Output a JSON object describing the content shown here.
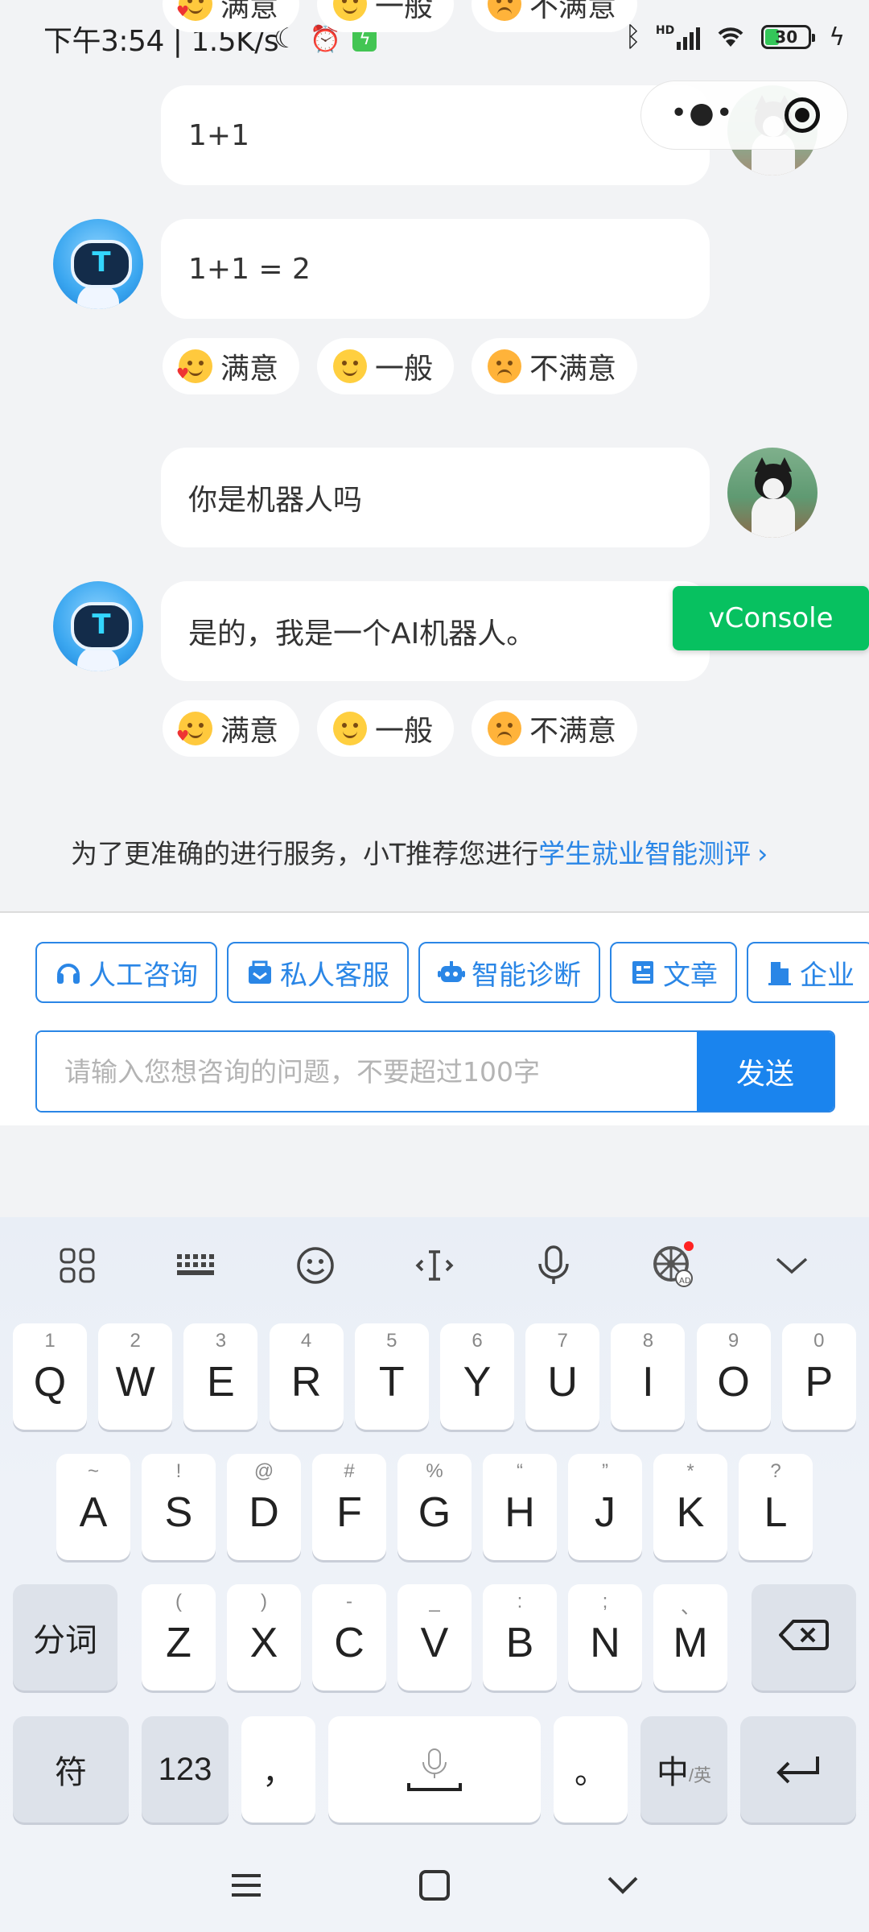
{
  "status_bar": {
    "left_text": "下午3:54 | 1.5K/s",
    "battery": "30",
    "hd_label": "HD"
  },
  "chat": {
    "messages": [
      {
        "role": "user",
        "text": "1+1"
      },
      {
        "role": "bot",
        "text": "1+1 = 2"
      },
      {
        "role": "user",
        "text": "你是机器人吗"
      },
      {
        "role": "bot",
        "text": "是的，我是一个AI机器人。"
      }
    ],
    "ratings": {
      "satisfied": "满意",
      "neutral": "一般",
      "unsatisfied": "不满意"
    },
    "bot_avatar_letter": "T"
  },
  "vconsole_label": "vConsole",
  "recommendation": {
    "prefix": "为了更准确的进行服务，小T推荐您进行",
    "link": "学生就业智能测评",
    "chevron": "›"
  },
  "quick_actions": [
    {
      "label": "人工咨询",
      "icon": "headphones-icon"
    },
    {
      "label": "私人客服",
      "icon": "service-icon"
    },
    {
      "label": "智能诊断",
      "icon": "robot-icon"
    },
    {
      "label": "文章",
      "icon": "article-icon"
    },
    {
      "label": "企业",
      "icon": "building-icon"
    }
  ],
  "input": {
    "placeholder": "请输入您想咨询的问题，不要超过100字",
    "value": "",
    "send_label": "发送"
  },
  "keyboard": {
    "row1": [
      {
        "key": "Q",
        "sub": "1"
      },
      {
        "key": "W",
        "sub": "2"
      },
      {
        "key": "E",
        "sub": "3"
      },
      {
        "key": "R",
        "sub": "4"
      },
      {
        "key": "T",
        "sub": "5"
      },
      {
        "key": "Y",
        "sub": "6"
      },
      {
        "key": "U",
        "sub": "7"
      },
      {
        "key": "I",
        "sub": "8"
      },
      {
        "key": "O",
        "sub": "9"
      },
      {
        "key": "P",
        "sub": "0"
      }
    ],
    "row2": [
      {
        "key": "A",
        "sub": "~"
      },
      {
        "key": "S",
        "sub": "!"
      },
      {
        "key": "D",
        "sub": "@"
      },
      {
        "key": "F",
        "sub": "#"
      },
      {
        "key": "G",
        "sub": "%"
      },
      {
        "key": "H",
        "sub": "“"
      },
      {
        "key": "J",
        "sub": "”"
      },
      {
        "key": "K",
        "sub": "*"
      },
      {
        "key": "L",
        "sub": "?"
      }
    ],
    "row3": [
      {
        "key": "Z",
        "sub": "("
      },
      {
        "key": "X",
        "sub": ")"
      },
      {
        "key": "C",
        "sub": "-"
      },
      {
        "key": "V",
        "sub": "_"
      },
      {
        "key": "B",
        "sub": ":"
      },
      {
        "key": "N",
        "sub": ";"
      },
      {
        "key": "M",
        "sub": "、"
      }
    ],
    "fenci": "分词",
    "fu": "符",
    "num": "123",
    "comma": "，",
    "period": "。",
    "lang_main": "中",
    "lang_sub": "/英",
    "ad_badge": "AD"
  },
  "colors": {
    "accent": "#1a84ee",
    "vconsole": "#07c160",
    "link": "#2a86e6"
  }
}
